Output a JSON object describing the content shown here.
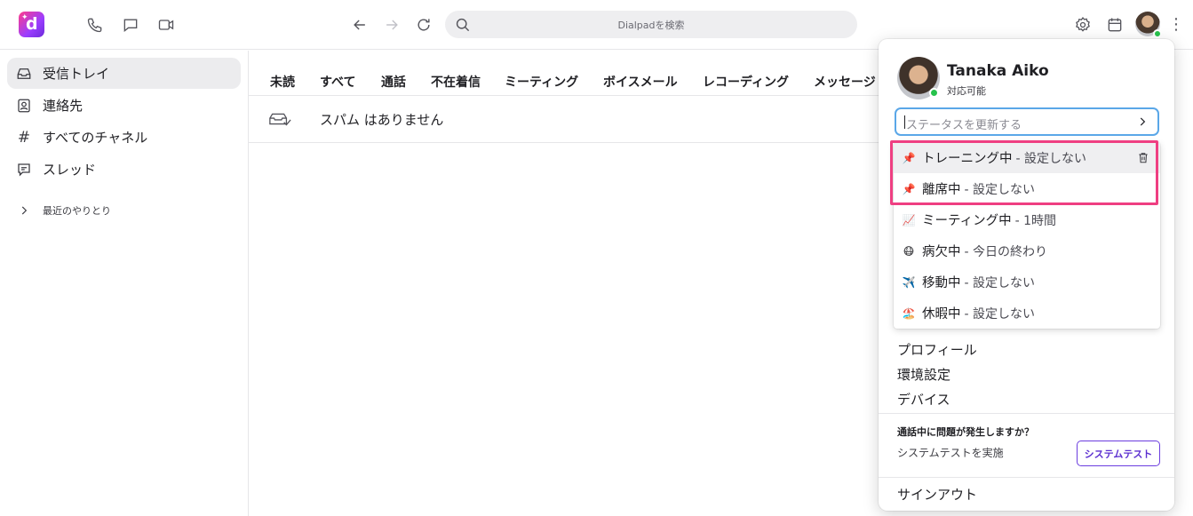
{
  "search": {
    "placeholder": "Dialpadを検索"
  },
  "sidebar": {
    "items": [
      {
        "label": "受信トレイ",
        "icon": "inbox-icon"
      },
      {
        "label": "連絡先",
        "icon": "contact-card-icon"
      },
      {
        "label": "すべてのチャネル",
        "icon": "hash-icon"
      },
      {
        "label": "スレッド",
        "icon": "thread-icon"
      }
    ],
    "recent": {
      "label": "最近のやりとり",
      "icon": "chevron-right-icon"
    }
  },
  "tabs": [
    "未読",
    "すべて",
    "通話",
    "不在着信",
    "ミーティング",
    "ボイスメール",
    "レコーディング",
    "メッセージ"
  ],
  "inbox": {
    "empty_text": "スパム はありません"
  },
  "profile": {
    "name": "Tanaka Aiko",
    "status": "対応可能",
    "status_input_placeholder": "ステータスを更新する",
    "presets": [
      {
        "emoji": "📌",
        "title": "トレーニング中",
        "duration": "- 設定しない"
      },
      {
        "emoji": "📌",
        "title": "離席中",
        "duration": "- 設定しない"
      },
      {
        "emoji": "📈",
        "title": "ミーティング中",
        "duration": "- 1時間"
      },
      {
        "emoji": "😷",
        "title": "病欠中",
        "duration": "- 今日の終わり"
      },
      {
        "emoji": "✈️",
        "title": "移動中",
        "duration": "- 設定しない"
      },
      {
        "emoji": "🏖️",
        "title": "休暇中",
        "duration": "- 設定しない"
      }
    ],
    "menu": [
      "プロフィール",
      "環境設定",
      "デバイス"
    ],
    "problem_question": "通話中に問題が発生しますか？",
    "problem_hint": "システムテストを実施",
    "system_test_button": "システムテスト",
    "sign_out": "サインアウト"
  },
  "colors": {
    "brand": "#9b3dff",
    "online": "#27c24c",
    "highlight": "#ef3f82",
    "focus": "#5aa7e8",
    "accent": "#5b2fd0"
  }
}
